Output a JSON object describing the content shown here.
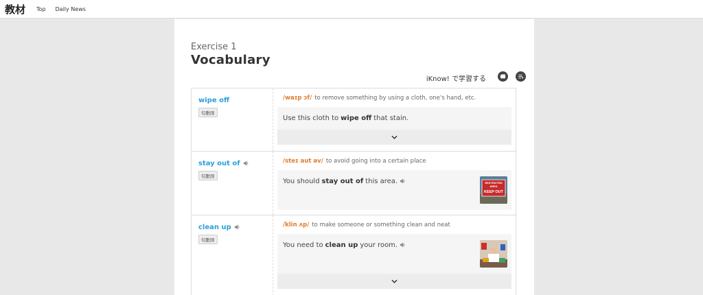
{
  "header": {
    "logo": "教材",
    "nav": [
      "Top",
      "Daily News"
    ]
  },
  "exercise": {
    "number": "Exercise 1",
    "title": "Vocabulary",
    "iknow_label": "iKnow! で学習する"
  },
  "entries": [
    {
      "word": "wipe off",
      "tag": "句動詞",
      "ipa": "/waɪp ɔf/",
      "definition": "to remove something by using a cloth, one's hand, etc.",
      "example_before": "Use this cloth to",
      "example_bold": "wipe off",
      "example_after": "that stain."
    },
    {
      "word": "stay out of",
      "tag": "句動詞",
      "ipa": "/steɪ aut əv/",
      "definition": "to avoid going into a certain place",
      "example_before": "You should",
      "example_bold": "stay out of",
      "example_after": "this area.",
      "image_text": [
        "RESTRICTED",
        "AREA",
        "KEEP OUT"
      ]
    },
    {
      "word": "clean up",
      "tag": "句動詞",
      "ipa": "/klin ʌp/",
      "definition": "to make someone or something clean and neat",
      "example_before": "You need to",
      "example_bold": "clean up",
      "example_after": "your room."
    }
  ],
  "colors": {
    "word": "#2a9fd8",
    "ipa": "#e07b2a",
    "background": "#e8e8e8"
  }
}
